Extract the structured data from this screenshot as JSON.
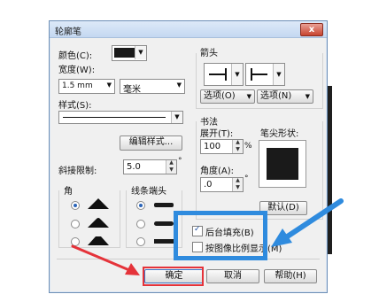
{
  "window": {
    "title": "轮廓笔",
    "close_label": "x"
  },
  "left": {
    "color_label": "颜色(C):",
    "width_label": "宽度(W):",
    "width_value": "1.5 mm",
    "unit_value": "毫米",
    "style_label": "样式(S):",
    "edit_style_label": "编辑样式...",
    "miter_label": "斜接限制:",
    "miter_value": "5.0",
    "corner_title": "角",
    "linecap_title": "线条端头"
  },
  "right": {
    "arrow_title": "箭头",
    "options_label_1": "选项(O)",
    "options_label_2": "选项(N)",
    "calligraphy_title": "书法",
    "stretch_label": "展开(T):",
    "stretch_value": "100",
    "stretch_unit": "%",
    "nib_shape_label": "笔尖形状:",
    "angle_label": "角度(A):",
    "angle_value": ".0",
    "angle_unit": "°",
    "default_label": "默认(D)",
    "behind_fill_label": "后台填充(B)",
    "scale_with_image_label": "按图像比例显示(M)"
  },
  "footer": {
    "ok": "确定",
    "cancel": "取消",
    "help": "帮助(H)"
  },
  "miter_unit": "°",
  "colors": {
    "highlight_blue": "#2f8bde",
    "red_arrow": "#e5333a",
    "color_swatch": "#1a1a1a"
  }
}
